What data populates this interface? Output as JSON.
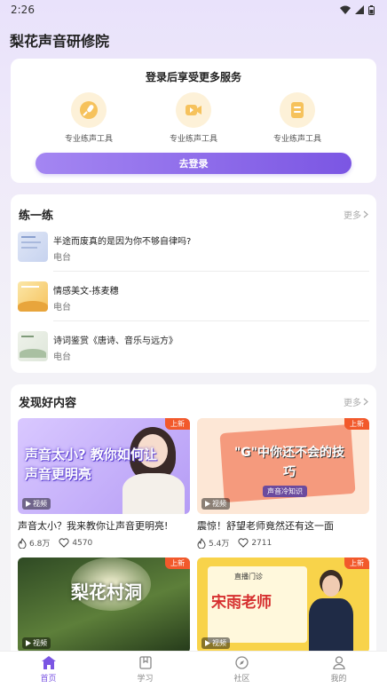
{
  "status_bar": {
    "time": "2:26"
  },
  "app": {
    "title": "梨花声音研修院"
  },
  "login": {
    "title": "登录后享受更多服务",
    "tools": [
      {
        "label": "专业练声工具",
        "icon": "microphone-icon"
      },
      {
        "label": "专业练声工具",
        "icon": "video-camera-icon"
      },
      {
        "label": "专业练声工具",
        "icon": "document-icon"
      }
    ],
    "button_label": "去登录"
  },
  "practice": {
    "title": "练一练",
    "more": "更多",
    "items": [
      {
        "name": "半途而废真的是因为你不够自律吗?",
        "tag": "电台"
      },
      {
        "name": "情感美文-拣麦穗",
        "tag": "电台"
      },
      {
        "name": "诗词鉴赏《唐诗、音乐与远方》",
        "tag": "电台"
      }
    ]
  },
  "discover": {
    "title": "发现好内容",
    "more": "更多",
    "videos": [
      {
        "badge": "上新",
        "tag": "视频",
        "thumb_text": "声音太小? 教你如何让声音更明亮",
        "title": "声音太小？我来教你让声音更明亮!",
        "likes": "6.8万",
        "comments": "4570"
      },
      {
        "badge": "上新",
        "tag": "视频",
        "thumb_text": "\"G\"中你还不会的技巧",
        "thumb_sub": "声音冷知识",
        "title": "震惊！舒望老师竟然还有这一面",
        "likes": "5.4万",
        "comments": "2711"
      },
      {
        "badge": "上新",
        "tag": "视频",
        "thumb_text": "梨花村洞"
      },
      {
        "badge": "上新",
        "tag": "视频",
        "thumb_text": "宋雨老师",
        "thumb_sub": "直播门诊"
      }
    ]
  },
  "nav": {
    "items": [
      {
        "label": "首页",
        "icon": "home-icon"
      },
      {
        "label": "学习",
        "icon": "bookmark-icon"
      },
      {
        "label": "社区",
        "icon": "compass-icon"
      },
      {
        "label": "我的",
        "icon": "user-icon"
      }
    ]
  },
  "colors": {
    "accent": "#7b56e3",
    "badge": "#f2592b",
    "tool_bg": "#fdf1d8"
  }
}
